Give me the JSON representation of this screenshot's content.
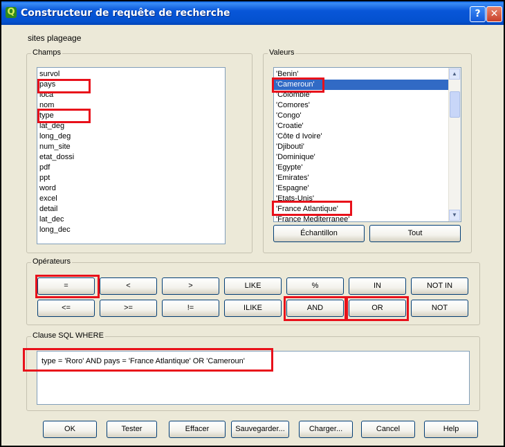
{
  "window": {
    "title": "Constructeur de requête de recherche",
    "help_label": "?",
    "close_label": "✕",
    "app_icon": "Q"
  },
  "layer_name": "sites plageage",
  "fields": {
    "legend": "Champs",
    "items": [
      "survol",
      "pays",
      "loca",
      "nom",
      "type",
      "lat_deg",
      "long_deg",
      "num_site",
      "etat_dossi",
      "pdf",
      "ppt",
      "word",
      "excel",
      "detail",
      "lat_dec",
      "long_dec"
    ]
  },
  "values": {
    "legend": "Valeurs",
    "items": [
      "'Benin'",
      "'Cameroun'",
      "'Colombie'",
      "'Comores'",
      "'Congo'",
      "'Croatie'",
      "'Côte d Ivoire'",
      "'Djibouti'",
      "'Dominique'",
      "'Egypte'",
      "'Emirates'",
      "'Espagne'",
      "'Etats-Unis'",
      "'France Atlantique'",
      "'France Mediterranee'"
    ],
    "selected_index": 1,
    "sample_label": "Échantillon",
    "all_label": "Tout"
  },
  "operators": {
    "legend": "Opérateurs",
    "row1": [
      "=",
      "<",
      ">",
      "LIKE",
      "%",
      "IN",
      "NOT IN"
    ],
    "row2": [
      "<=",
      ">=",
      "!=",
      "ILIKE",
      "AND",
      "OR",
      "NOT"
    ]
  },
  "sql": {
    "legend": "Clause SQL WHERE",
    "text": "type = 'Roro' AND pays = 'France Atlantique' OR 'Cameroun'"
  },
  "footer_buttons": [
    "OK",
    "Tester",
    "Effacer",
    "Sauvegarder...",
    "Charger...",
    "Cancel",
    "Help"
  ],
  "colors": {
    "highlight_box": "#e8101a",
    "selection": "#316ac5",
    "titlebar": "#0451cf",
    "dialog_bg": "#ece9d8"
  },
  "icons": {
    "scroll_up": "▲",
    "scroll_down": "▼"
  }
}
